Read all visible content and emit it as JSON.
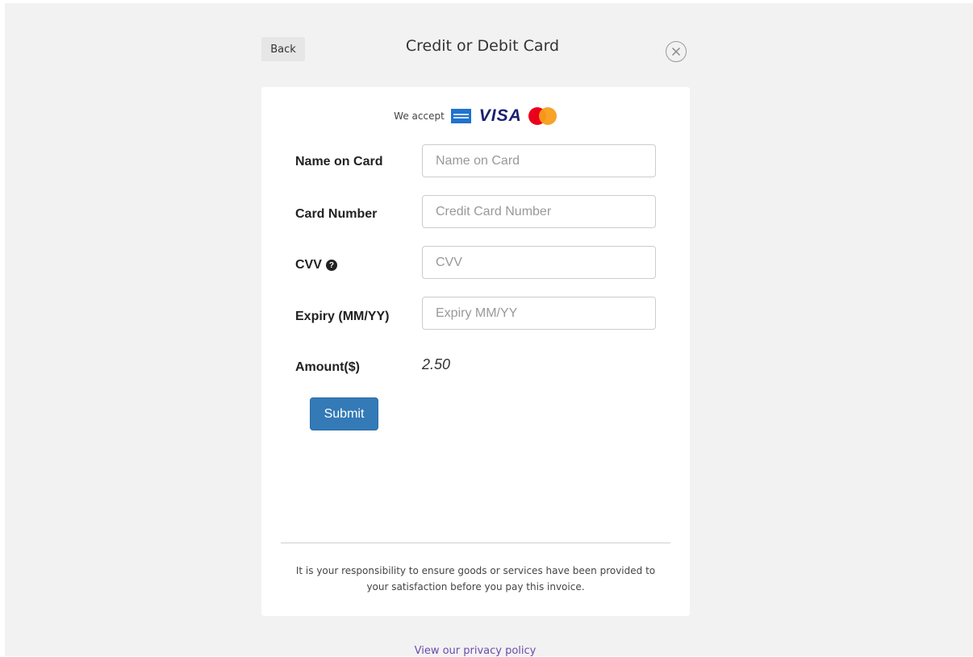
{
  "header": {
    "back_label": "Back",
    "title": "Credit or Debit Card"
  },
  "accept": {
    "text": "We accept",
    "brands": [
      "amex-icon",
      "visa-icon",
      "mastercard-icon"
    ],
    "visa_text": "VISA"
  },
  "form": {
    "name": {
      "label": "Name on Card",
      "placeholder": "Name on Card",
      "value": ""
    },
    "card_number": {
      "label": "Card Number",
      "placeholder": "Credit Card Number",
      "value": ""
    },
    "cvv": {
      "label": "CVV",
      "placeholder": "CVV",
      "value": ""
    },
    "expiry": {
      "label": "Expiry (MM/YY)",
      "placeholder": "Expiry MM/YY",
      "value": ""
    },
    "amount": {
      "label": "Amount($)",
      "value": "2.50"
    },
    "submit_label": "Submit"
  },
  "disclaimer": {
    "line1": "It is your responsibility to ensure goods or services have been provided to",
    "line2": "your satisfaction before you pay this invoice."
  },
  "footer": {
    "privacy_link": "View our privacy policy"
  },
  "colors": {
    "primary_button": "#337ab7",
    "link": "#6b4bb0",
    "background": "#f2f2f2"
  }
}
